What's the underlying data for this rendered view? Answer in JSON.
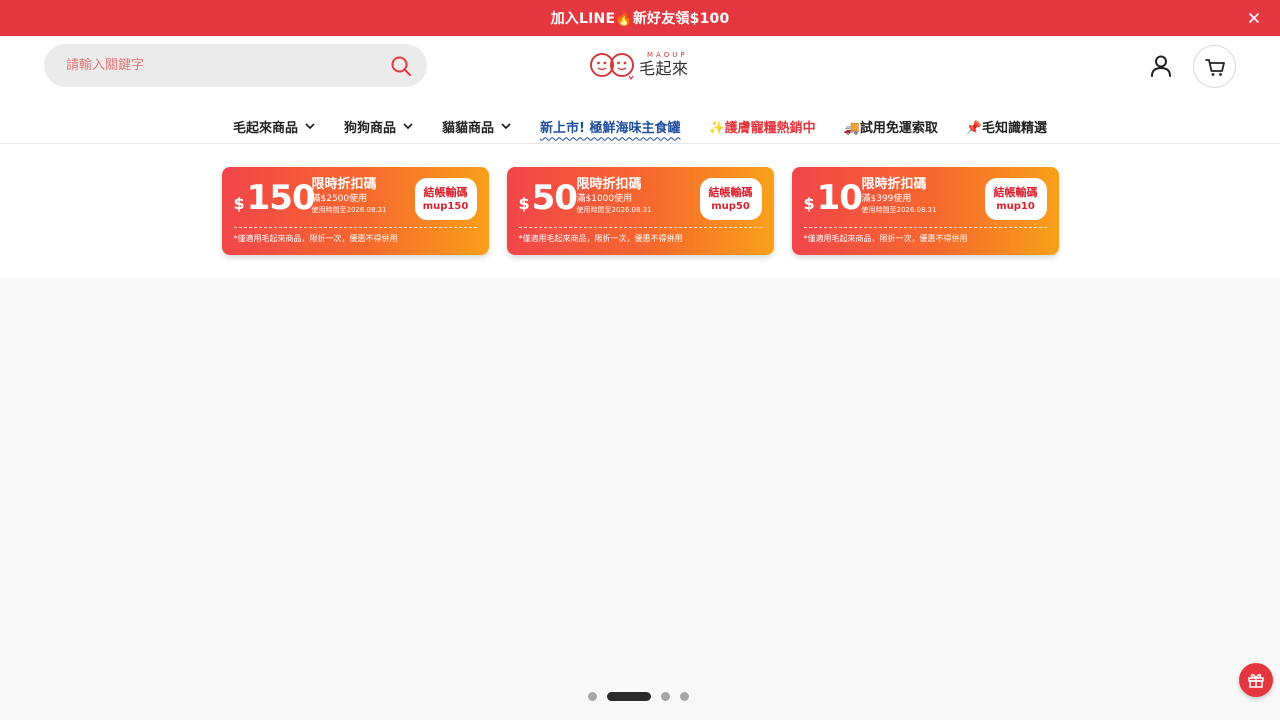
{
  "announcement": {
    "text": "加入LINE🔥新好友領$100"
  },
  "search": {
    "placeholder": "請輸入關鍵字"
  },
  "logo": {
    "sub": "MAOUP",
    "name": "毛起來"
  },
  "colors": {
    "brand_red": "#e4373f",
    "nav_blue": "#1f4e9e",
    "coupon_start": "#f2454a",
    "coupon_end": "#f9a01a"
  },
  "icons": {
    "search": "search-icon",
    "account": "user-icon",
    "cart": "cart-icon",
    "close": "close-icon",
    "gift": "gift-icon"
  },
  "nav": [
    {
      "label": "毛起來商品"
    },
    {
      "label": "狗狗商品"
    },
    {
      "label": "貓貓商品"
    },
    {
      "label": "新上市! 極鮮海味主食罐"
    },
    {
      "label": "✨護膚寵糧熱銷中"
    },
    {
      "label": "🚚試用免運索取"
    },
    {
      "label": "📌毛知識精選"
    }
  ],
  "coupons": [
    {
      "currency": "$",
      "amount": "150",
      "title": "限時折扣碼",
      "min_spend": "滿$2500使用",
      "expiry": "使用時間至2026.08.31",
      "code_label": "結帳輸碼",
      "code": "mup150",
      "note": "*僅適用毛起來商品，限折一次，優惠不得併用"
    },
    {
      "currency": "$",
      "amount": "50",
      "title": "限時折扣碼",
      "min_spend": "滿$1000使用",
      "expiry": "使用時間至2026.08.31",
      "code_label": "結帳輸碼",
      "code": "mup50",
      "note": "*僅適用毛起來商品，限折一次，優惠不得併用"
    },
    {
      "currency": "$",
      "amount": "10",
      "title": "限時折扣碼",
      "min_spend": "滿$399使用",
      "expiry": "使用時間至2026.08.31",
      "code_label": "結帳輸碼",
      "code": "mup10",
      "note": "*僅適用毛起來商品，限折一次，優惠不得併用"
    }
  ],
  "carousel": {
    "slide_count": 4,
    "active_index": 1
  }
}
